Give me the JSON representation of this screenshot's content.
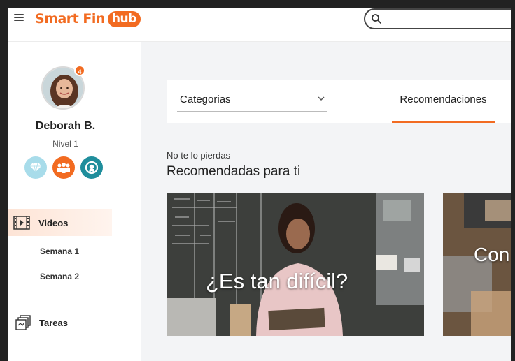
{
  "header": {
    "logo_text": "Smart Fin",
    "logo_badge": "hub",
    "search_placeholder": ""
  },
  "profile": {
    "name": "Deborah B.",
    "level": "Nivel 1",
    "notification_count": "4"
  },
  "sidebar": {
    "items": [
      {
        "label": "Videos"
      },
      {
        "label": "Semana 1"
      },
      {
        "label": "Semana 2"
      },
      {
        "label": "Tareas"
      }
    ]
  },
  "filters": {
    "dropdown_label": "Categorias",
    "tab_label": "Recomendaciones"
  },
  "section": {
    "eyebrow": "No te lo pierdas",
    "title": "Recomendadas para ti"
  },
  "cards": [
    {
      "title": "¿Es tan difícil?"
    },
    {
      "title": "Con"
    }
  ],
  "colors": {
    "brand_orange": "#f26b21",
    "badge_diamond": "#a8dcea",
    "badge_group": "#f26b21",
    "badge_award": "#1f8e9c"
  }
}
